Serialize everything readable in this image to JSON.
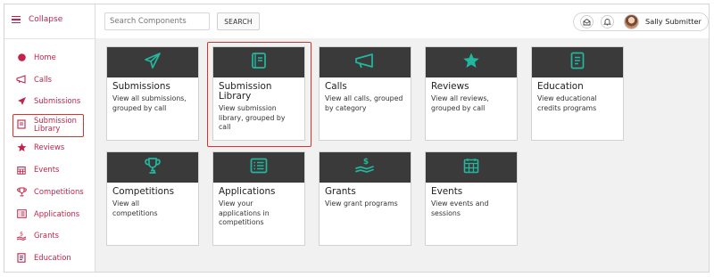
{
  "colors": {
    "accent": "#c0244a",
    "teal": "#22b8a0",
    "card_header": "#3a3a3a",
    "highlight": "#d9322f"
  },
  "sidebar": {
    "collapse_label": "Collapse",
    "items": [
      {
        "label": "Home",
        "icon": "home-dot-icon"
      },
      {
        "label": "Calls",
        "icon": "megaphone-icon"
      },
      {
        "label": "Submissions",
        "icon": "paper-plane-icon"
      },
      {
        "label": "Submission Library",
        "icon": "book-icon"
      },
      {
        "label": "Reviews",
        "icon": "star-icon"
      },
      {
        "label": "Events",
        "icon": "calendar-icon"
      },
      {
        "label": "Competitions",
        "icon": "trophy-icon"
      },
      {
        "label": "Applications",
        "icon": "list-icon"
      },
      {
        "label": "Grants",
        "icon": "hand-money-icon"
      },
      {
        "label": "Education",
        "icon": "document-icon"
      }
    ]
  },
  "search": {
    "placeholder": "Search Components",
    "button_label": "SEARCH"
  },
  "user": {
    "name": "Sally Submitter"
  },
  "cards": [
    {
      "title": "Submissions",
      "desc": "View all submissions, grouped by call",
      "icon": "paper-plane-icon"
    },
    {
      "title": "Submission Library",
      "desc": "View submission library, grouped by call",
      "icon": "book-icon"
    },
    {
      "title": "Calls",
      "desc": "View all calls, grouped by category",
      "icon": "megaphone-icon"
    },
    {
      "title": "Reviews",
      "desc": "View all reviews, grouped by call",
      "icon": "star-icon"
    },
    {
      "title": "Education",
      "desc": "View educational credits programs",
      "icon": "document-icon"
    },
    {
      "title": "Competitions",
      "desc": "View all competitions",
      "icon": "trophy-icon"
    },
    {
      "title": "Applications",
      "desc": "View your applications in competitions",
      "icon": "list-icon"
    },
    {
      "title": "Grants",
      "desc": "View grant programs",
      "icon": "hand-money-icon"
    },
    {
      "title": "Events",
      "desc": "View events and sessions",
      "icon": "calendar-icon"
    }
  ]
}
